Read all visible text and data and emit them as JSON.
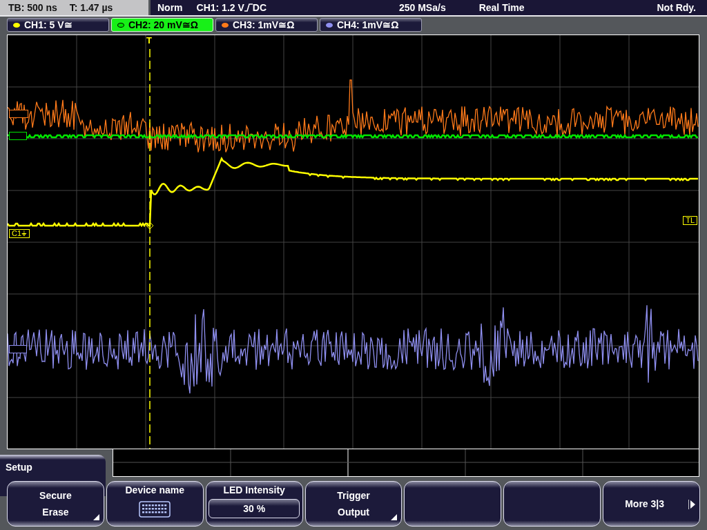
{
  "header": {
    "timebase": "TB: 500 ns",
    "trigger_time": "T: 1.47 µs",
    "trigger_mode": "Norm",
    "trigger_source": "CH1: 1.2 V",
    "trigger_coupling": "DC",
    "sample_rate": "250 MSa/s",
    "acquisition": "Real Time",
    "status": "Not Rdy."
  },
  "channels": [
    {
      "label": "CH1: 5 V≅",
      "color": "#ffff00",
      "selected": false
    },
    {
      "label": "CH2: 20 mV≅Ω",
      "color": "#00e600",
      "selected": true
    },
    {
      "label": "CH3: 1mV≅Ω",
      "color": "#ff7a1a",
      "selected": false
    },
    {
      "label": "CH4: 1mV≅Ω",
      "color": "#8f8ff0",
      "selected": false
    }
  ],
  "scope": {
    "trigger_marker": "T",
    "ground_label": "C1⏚",
    "trigger_level_label": "TL"
  },
  "menu": {
    "title": "Setup",
    "softkeys": [
      {
        "kind": "submenu",
        "lines": [
          "Secure",
          "Erase"
        ]
      },
      {
        "kind": "keyboard",
        "lines": [
          "Device name"
        ]
      },
      {
        "kind": "value",
        "lines": [
          "LED Intensity"
        ],
        "value": "30 %"
      },
      {
        "kind": "submenu",
        "lines": [
          "Trigger",
          "Output"
        ]
      },
      {
        "kind": "empty"
      },
      {
        "kind": "empty"
      },
      {
        "kind": "more",
        "lines": [
          "More 3|3"
        ]
      }
    ]
  }
}
